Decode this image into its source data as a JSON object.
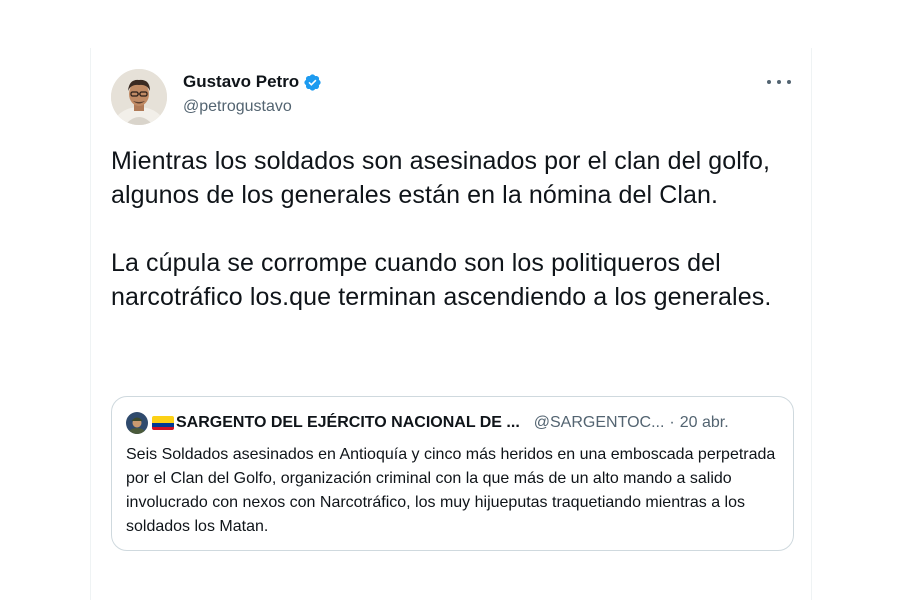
{
  "tweet": {
    "author_name": "Gustavo Petro",
    "author_handle": "@petrogustavo",
    "text": "Mientras los soldados son asesinados por el clan del golfo, algunos de los generales están en la nómina del Clan.\n\nLa cúpula se corrompe cuando son los politiqueros del narcotráfico los.que terminan ascendiendo a los generales.",
    "verified": true,
    "more_icon": "more-horizontal-icon"
  },
  "quoted_tweet": {
    "author_name": "SARGENTO DEL EJÉRCITO NACIONAL DE ...",
    "author_handle": "@SARGENTOC...",
    "separator": "·",
    "date": "20 abr.",
    "flag_icon": "colombia-flag-icon",
    "text": "Seis Soldados asesinados en Antioquía y cinco más heridos en una emboscada perpetrada por el Clan del Golfo, organización criminal con la que más de un alto mando a salido involucrado con nexos con Narcotráfico, los muy hijueputas traquetiando mientras a los soldados los Matan."
  },
  "colors": {
    "text_primary": "#0f1419",
    "text_secondary": "#536471",
    "verified_blue": "#1d9bf0",
    "border": "#cfd9de"
  }
}
